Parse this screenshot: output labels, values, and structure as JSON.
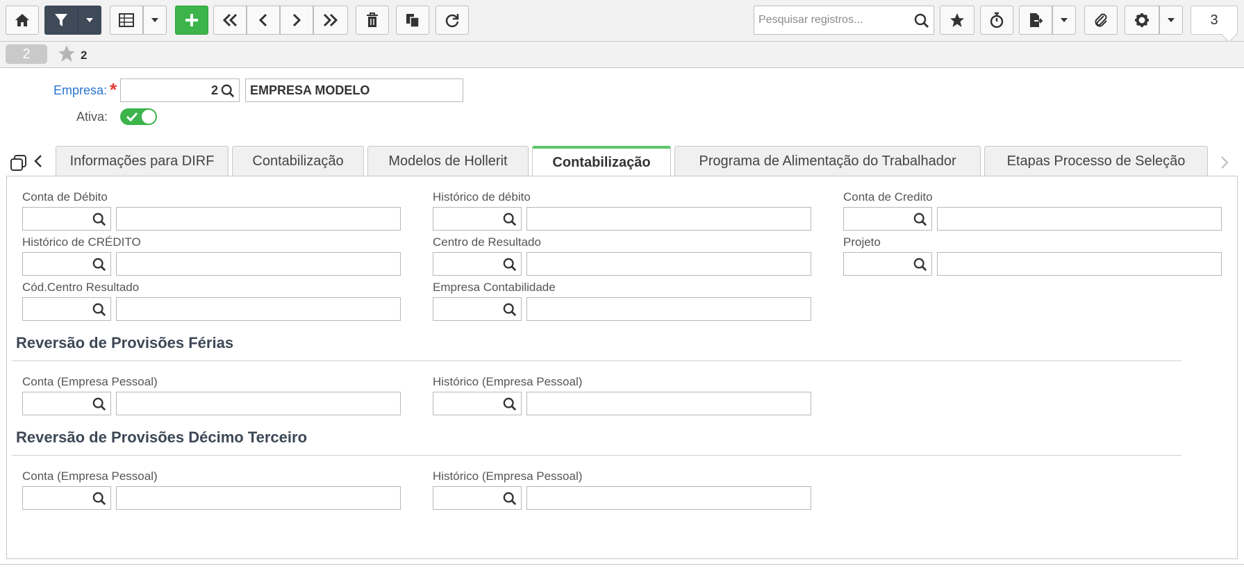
{
  "toolbar": {
    "search_placeholder": "Pesquisar registros...",
    "record_total": "3",
    "icons": [
      "home-icon",
      "filter-icon",
      "grid-icon",
      "plus-icon",
      "first-icon",
      "prev-icon",
      "next-icon",
      "last-icon",
      "trash-icon",
      "copy-icon",
      "refresh-icon",
      "search-icon",
      "star-icon",
      "timer-icon",
      "export-icon",
      "paperclip-icon",
      "gear-icon"
    ],
    "colors": {
      "filter_bg": "#3f4a59",
      "add_bg": "#3cb44b"
    }
  },
  "record_bar": {
    "current": "2",
    "favorites_count": "2"
  },
  "header": {
    "empresa_label": "Empresa:",
    "empresa_code": "2",
    "empresa_name": "EMPRESA MODELO",
    "ativa_label": "Ativa:",
    "ativa_value": true
  },
  "tabs": [
    {
      "label": "Informações para DIRF",
      "active": false
    },
    {
      "label": "Contabilização",
      "active": false
    },
    {
      "label": "Modelos de Hollerit",
      "active": false
    },
    {
      "label": "Contabilização",
      "active": true
    },
    {
      "label": "Programa de Alimentação do Trabalhador",
      "active": false
    },
    {
      "label": "Etapas Processo de Seleção",
      "active": false
    }
  ],
  "fields": {
    "conta_debito": "Conta de Débito",
    "historico_debito": "Histórico de débito",
    "conta_credito": "Conta de Credito",
    "historico_credito": "Histórico de CRÉDITO",
    "centro_resultado": "Centro de Resultado",
    "projeto": "Projeto",
    "cod_centro_resultado": "Cód.Centro Resultado",
    "empresa_contabilidade": "Empresa Contabilidade"
  },
  "sections": {
    "ferias": {
      "title": "Reversão de Provisões Férias",
      "conta_label": "Conta (Empresa Pessoal)",
      "historico_label": "Histórico (Empresa Pessoal)"
    },
    "decimo": {
      "title": "Reversão de Provisões Décimo Terceiro",
      "conta_label": "Conta (Empresa Pessoal)",
      "historico_label": "Histórico (Empresa Pessoal)"
    }
  }
}
